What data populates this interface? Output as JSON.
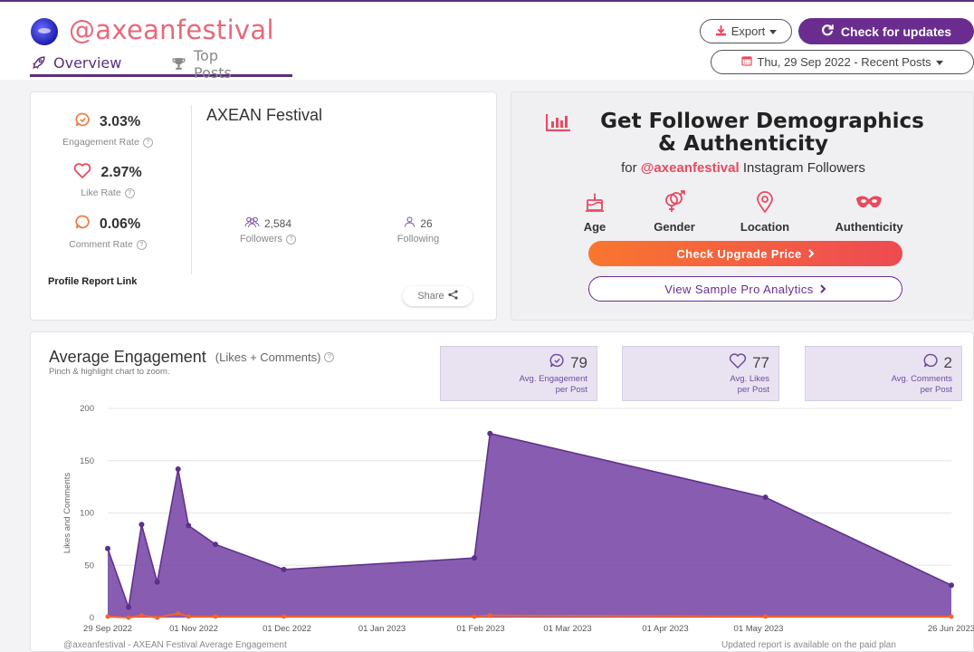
{
  "header": {
    "handle": "@axeanfestival",
    "tabs": [
      {
        "label": "Overview",
        "icon": "rocket-icon"
      },
      {
        "label": "Top Posts",
        "icon": "trophy-icon"
      }
    ],
    "export_label": "Export",
    "update_label": "Check for updates",
    "date_label": "Thu, 29 Sep 2022 - Recent Posts"
  },
  "stats": {
    "engagement": {
      "value": "3.03%",
      "label": "Engagement Rate"
    },
    "like": {
      "value": "2.97%",
      "label": "Like Rate"
    },
    "comment": {
      "value": "0.06%",
      "label": "Comment Rate"
    },
    "profile_name": "AXEAN Festival",
    "followers": {
      "value": "2,584",
      "label": "Followers"
    },
    "following": {
      "value": "26",
      "label": "Following"
    },
    "profile_link": "Profile Report Link",
    "share": "Share"
  },
  "demographics": {
    "title_line1": "Get Follower Demographics",
    "title_line2": "& Authenticity",
    "sub_prefix": "for",
    "sub_handle": "@axeanfestival",
    "sub_suffix": "Instagram Followers",
    "items": [
      "Age",
      "Gender",
      "Location",
      "Authenticity"
    ],
    "upgrade_label": "Check Upgrade Price",
    "sample_label": "View Sample Pro Analytics",
    "accent": "#e84a5f",
    "brand": "#6a2d8f"
  },
  "engagement": {
    "title": "Average Engagement",
    "subtitle": "(Likes + Comments)",
    "hint": "Pinch & highlight chart to zoom.",
    "boxes": [
      {
        "value": "79",
        "line1": "Avg. Engagement",
        "line2": "per Post",
        "icon": "engagement-icon"
      },
      {
        "value": "77",
        "line1": "Avg. Likes",
        "line2": "per Post",
        "icon": "heart-icon"
      },
      {
        "value": "2",
        "line1": "Avg. Comments",
        "line2": "per Post",
        "icon": "comment-icon"
      }
    ],
    "footer_left": "@axeanfestival - AXEAN Festival Average Engagement",
    "footer_right": "Updated report is available on the paid plan"
  },
  "chart_data": {
    "type": "area",
    "ylabel": "Likes and Comments",
    "ylim": [
      0,
      200
    ],
    "yticks": [
      0,
      50,
      100,
      150,
      200
    ],
    "xticks": [
      "29 Sep 2022",
      "01 Nov 2022",
      "01 Dec 2022",
      "01 Jan 2023",
      "01 Feb 2023",
      "01 Mar 2023",
      "01 Apr 2023",
      "01 May 2023",
      "26 Jun 2023"
    ],
    "grid": true,
    "series": [
      {
        "color": "#7a4aa8",
        "points": [
          {
            "x": "2022-09-29",
            "y": 66
          },
          {
            "x": "2022-10-07",
            "y": 10
          },
          {
            "x": "2022-10-12",
            "y": 89
          },
          {
            "x": "2022-10-18",
            "y": 34
          },
          {
            "x": "2022-10-26",
            "y": 142
          },
          {
            "x": "2022-10-30",
            "y": 88
          },
          {
            "x": "2022-11-08",
            "y": 70
          },
          {
            "x": "2022-11-30",
            "y": 46
          },
          {
            "x": "2023-01-30",
            "y": 57
          },
          {
            "x": "2023-02-04",
            "y": 176
          },
          {
            "x": "2023-05-03",
            "y": 115
          },
          {
            "x": "2023-06-26",
            "y": 31
          }
        ]
      },
      {
        "color": "#f4632c",
        "points": [
          {
            "x": "2022-09-29",
            "y": 1
          },
          {
            "x": "2022-10-07",
            "y": 0
          },
          {
            "x": "2022-10-12",
            "y": 2
          },
          {
            "x": "2022-10-18",
            "y": 0
          },
          {
            "x": "2022-10-26",
            "y": 4
          },
          {
            "x": "2022-10-30",
            "y": 1
          },
          {
            "x": "2022-11-08",
            "y": 1
          },
          {
            "x": "2022-11-30",
            "y": 1
          },
          {
            "x": "2023-01-30",
            "y": 1
          },
          {
            "x": "2023-02-04",
            "y": 2
          },
          {
            "x": "2023-05-03",
            "y": 1
          },
          {
            "x": "2023-06-26",
            "y": 1
          }
        ]
      }
    ]
  }
}
